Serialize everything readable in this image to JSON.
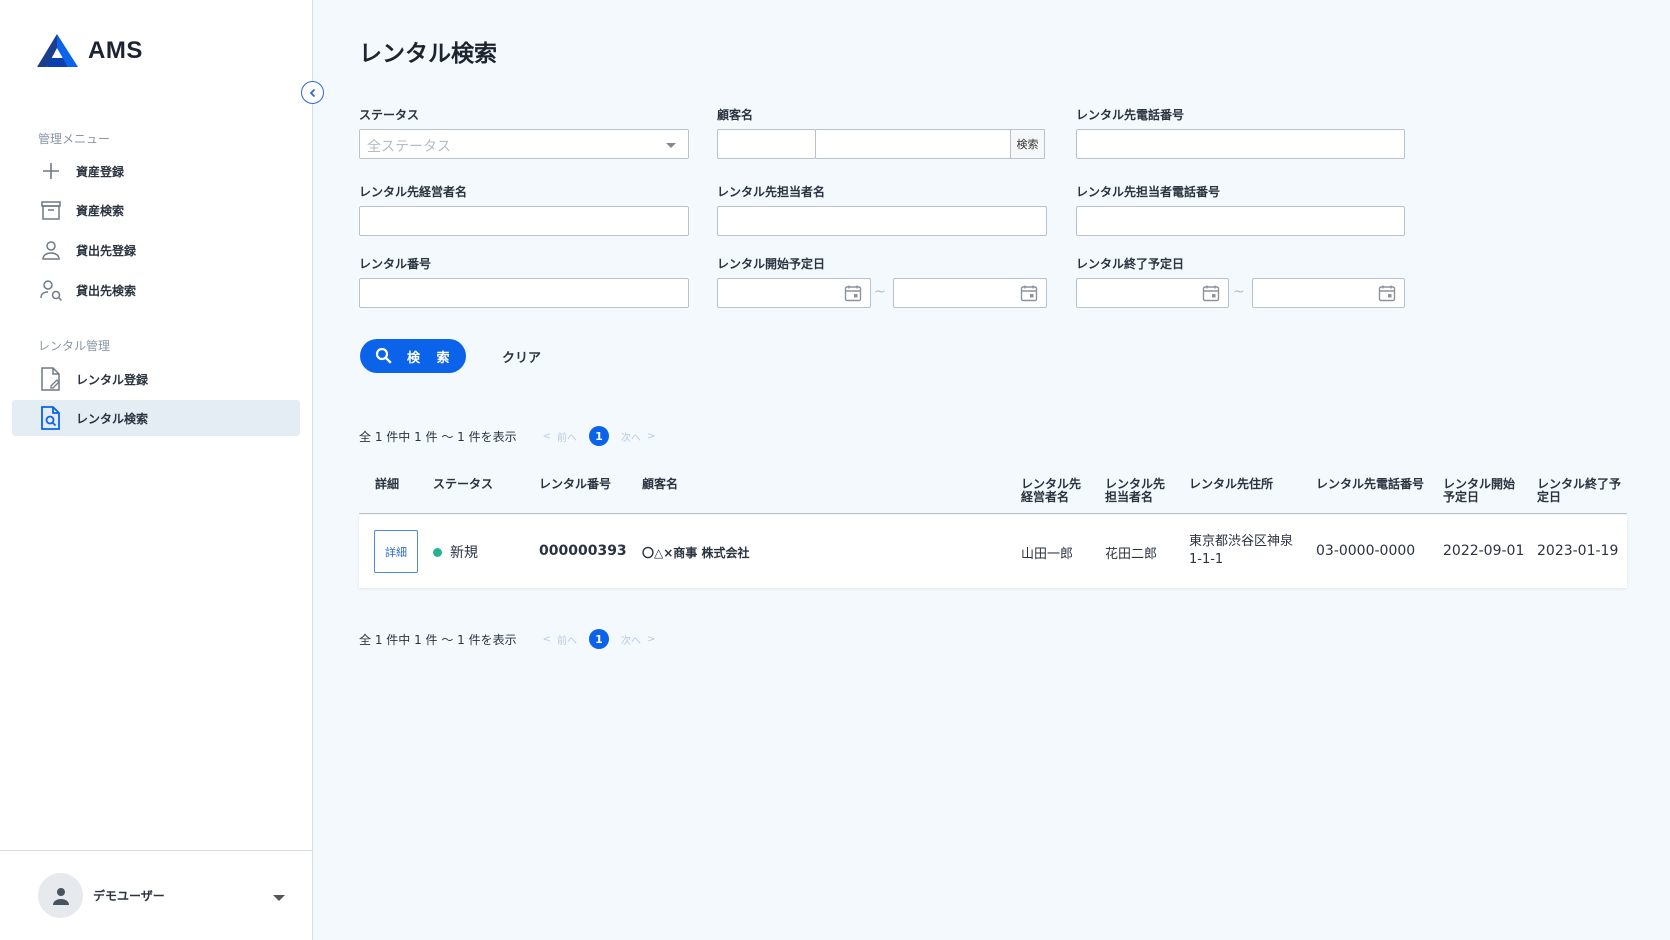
{
  "app": {
    "name": "AMS"
  },
  "sidebar": {
    "sections": [
      {
        "label": "管理メニュー"
      },
      {
        "label": "レンタル管理"
      }
    ],
    "items": [
      {
        "label": "資産登録",
        "icon": "plus-icon"
      },
      {
        "label": "資産検索",
        "icon": "archive-icon"
      },
      {
        "label": "貸出先登録",
        "icon": "person-icon"
      },
      {
        "label": "貸出先検索",
        "icon": "person-search-icon"
      },
      {
        "label": "レンタル登録",
        "icon": "document-edit-icon"
      },
      {
        "label": "レンタル検索",
        "icon": "document-search-icon",
        "active": true
      }
    ],
    "user": {
      "name": "デモユーザー"
    }
  },
  "page": {
    "title": "レンタル検索"
  },
  "form": {
    "status_label": "ステータス",
    "status_placeholder": "全ステータス",
    "customer_label": "顧客名",
    "customer_search_button": "検索",
    "phone_label": "レンタル先電話番号",
    "manager_label": "レンタル先経営者名",
    "contact_label": "レンタル先担当者名",
    "contact_phone_label": "レンタル先担当者電話番号",
    "rental_no_label": "レンタル番号",
    "start_date_label": "レンタル開始予定日",
    "end_date_label": "レンタル終了予定日",
    "range_sep": "~",
    "search_button": "検 索",
    "clear_button": "クリア"
  },
  "results": {
    "summary": "全 1 件中 1 件 〜 1 件を表示",
    "prev": "前へ",
    "next": "次へ",
    "current_page": "1"
  },
  "table": {
    "headers": {
      "detail": "詳細",
      "status": "ステータス",
      "rental_no": "レンタル番号",
      "customer": "顧客名",
      "manager": "レンタル先経営者名",
      "contact": "レンタル先担当者名",
      "address": "レンタル先住所",
      "phone": "レンタル先電話番号",
      "start": "レンタル開始予定日",
      "end": "レンタル終了予定日"
    },
    "rows": [
      {
        "detail_button": "詳細",
        "status": "新規",
        "rental_no": "000000393",
        "customer": "〇△×商事 株式会社",
        "manager": "山田一郎",
        "contact": "花田二郎",
        "address": "東京都渋谷区神泉1-1-1",
        "phone": "03-0000-0000",
        "start": "2022-09-01",
        "end": "2023-01-19"
      }
    ]
  },
  "colors": {
    "accent": "#0a63e9",
    "status_new": "#24b58f",
    "background": "#f3f9fd"
  }
}
